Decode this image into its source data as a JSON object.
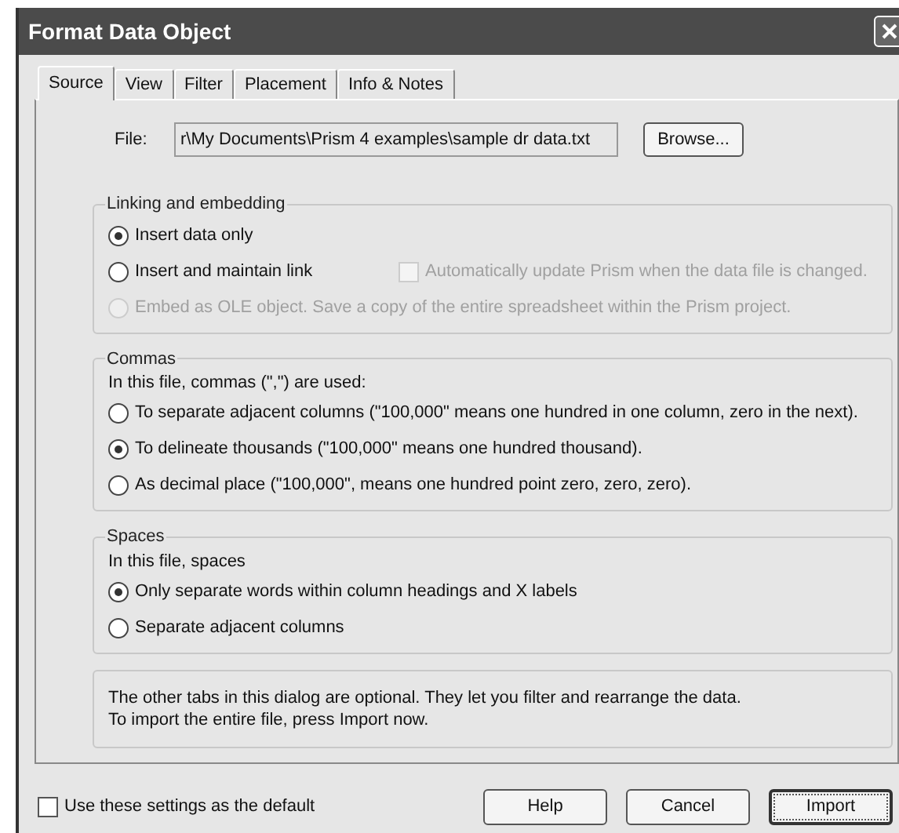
{
  "window": {
    "title": "Format Data Object"
  },
  "tabs": [
    {
      "label": "Source",
      "selected": true
    },
    {
      "label": "View",
      "selected": false
    },
    {
      "label": "Filter",
      "selected": false
    },
    {
      "label": "Placement",
      "selected": false
    },
    {
      "label": "Info & Notes",
      "selected": false
    }
  ],
  "file": {
    "label": "File:",
    "value": "r\\My Documents\\Prism 4 examples\\sample dr data.txt",
    "browse_button": "Browse..."
  },
  "linking": {
    "title": "Linking and embedding",
    "options": [
      {
        "label": "Insert data only",
        "selected": true,
        "disabled": false
      },
      {
        "label": "Insert and maintain link",
        "selected": false,
        "disabled": false,
        "checkbox": {
          "label": "Automatically update Prism when the data file is changed.",
          "checked": false,
          "disabled": true
        }
      },
      {
        "label": "Embed as OLE object. Save a copy of the entire spreadsheet within the Prism project.",
        "selected": false,
        "disabled": true
      }
    ]
  },
  "commas": {
    "title": "Commas",
    "intro": "In this file, commas (\",\") are used:",
    "options": [
      {
        "label": "To separate adjacent columns (\"100,000\" means one hundred in one column, zero in the next).",
        "selected": false,
        "disabled": false
      },
      {
        "label": "To delineate thousands (\"100,000\" means one hundred thousand).",
        "selected": true,
        "disabled": false
      },
      {
        "label": "As decimal place (\"100,000\", means one hundred point zero, zero, zero).",
        "selected": false,
        "disabled": false
      }
    ]
  },
  "spaces": {
    "title": "Spaces",
    "intro": "In this file, spaces",
    "options": [
      {
        "label": "Only separate words within column headings and X labels",
        "selected": true,
        "disabled": false
      },
      {
        "label": "Separate adjacent columns",
        "selected": false,
        "disabled": false
      }
    ]
  },
  "note": [
    "The other tabs in this dialog are optional. They let you filter and rearrange the data.",
    "To import the entire file, press Import now."
  ],
  "default_checkbox": {
    "label": "Use these settings as the default",
    "checked": false
  },
  "buttons": [
    {
      "label": "Help",
      "default": false
    },
    {
      "label": "Cancel",
      "default": false
    },
    {
      "label": "Import",
      "default": true
    }
  ]
}
